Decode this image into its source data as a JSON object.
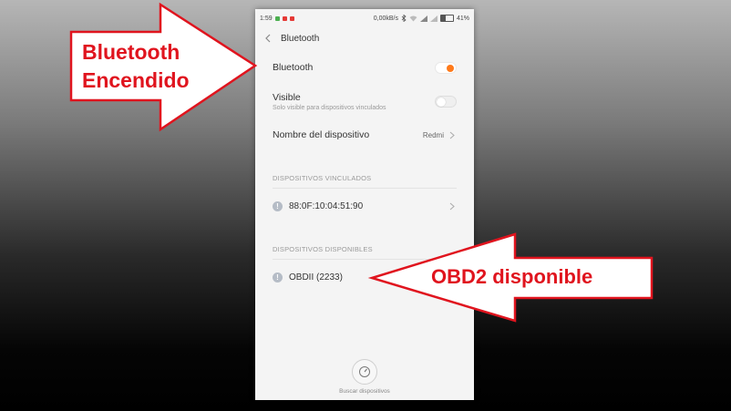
{
  "status_bar": {
    "time": "1:59",
    "network_speed": "0,00kB/s",
    "battery": "41%",
    "battery_level": 0.41
  },
  "header": {
    "title": "Bluetooth"
  },
  "settings": {
    "bluetooth": {
      "label": "Bluetooth",
      "on": true
    },
    "visible": {
      "label": "Visible",
      "sublabel": "Solo visible para dispositivos vinculados",
      "on": false
    },
    "device_name": {
      "label": "Nombre del dispositivo",
      "value": "Redmi"
    }
  },
  "paired": {
    "header": "DISPOSITIVOS VINCULADOS",
    "devices": [
      {
        "name": "88:0F:10:04:51:90"
      }
    ]
  },
  "available": {
    "header": "DISPOSITIVOS DISPONIBLES",
    "devices": [
      {
        "name": "OBDII (2233)"
      }
    ]
  },
  "scan": {
    "label": "Buscar dispositivos",
    "icon": "gauge-icon"
  },
  "annotations": {
    "bluetooth_on": {
      "line1": "Bluetooth",
      "line2": "Encendido"
    },
    "obd2": {
      "text": "OBD2 disponible"
    }
  },
  "colors": {
    "accent": "#ff7a1a",
    "callout_text": "#e0141e",
    "callout_border": "#e0141e"
  }
}
